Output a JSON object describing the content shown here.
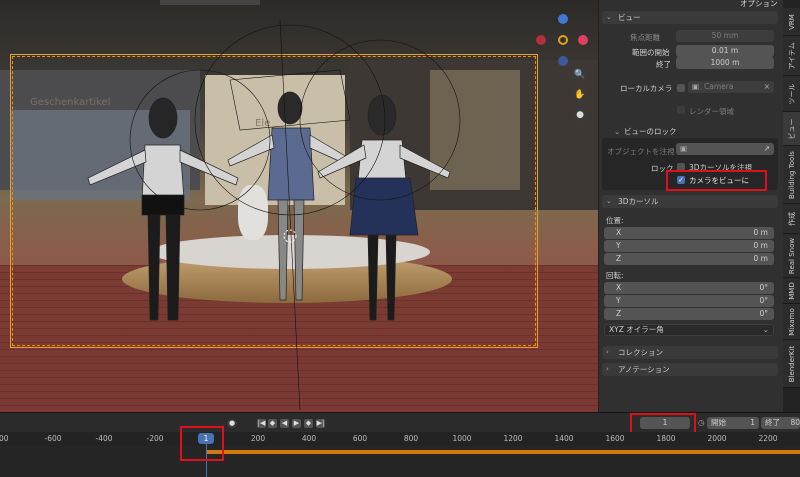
{
  "viewport": {
    "shop_sign": "Geschenkartikel",
    "shop_sign_partial": "Ele"
  },
  "npanel": {
    "section_view": "ビュー",
    "focal_length_label": "焦点距離",
    "focal_length_value": "50 mm",
    "clip_start_label": "範囲の開始",
    "clip_start_value": "0.01 m",
    "clip_end_label": "終了",
    "clip_end_value": "1000 m",
    "local_camera_label": "ローカルカメラ",
    "local_camera_value": "Camera",
    "render_region_label": "レンダー領域",
    "section_view_lock": "ビューのロック",
    "lock_object_label": "オブジェクトを注視",
    "lock_label": "ロック",
    "lock_3d_cursor_label": "3Dカーソルを注視",
    "camera_to_view_label": "カメラをビューに",
    "section_3d_cursor": "3Dカーソル",
    "location_label": "位置:",
    "rotation_label": "回転:",
    "loc": [
      {
        "axis": "X",
        "value": "0 m"
      },
      {
        "axis": "Y",
        "value": "0 m"
      },
      {
        "axis": "Z",
        "value": "0 m"
      }
    ],
    "rot": [
      {
        "axis": "X",
        "value": "0°"
      },
      {
        "axis": "Y",
        "value": "0°"
      },
      {
        "axis": "Z",
        "value": "0°"
      }
    ],
    "rotation_mode": "XYZ オイラー角",
    "section_collection": "コレクション",
    "section_annotation": "アノテーション",
    "top_right": "オプション"
  },
  "tabs": [
    "VRM",
    "アイテム",
    "ツール",
    "ビュー",
    "Building Tools",
    "作成",
    "Real Snow",
    "MMD",
    "Mixamo",
    "BlenderKit"
  ],
  "timeline": {
    "current_frame": "1",
    "start_label": "開始",
    "start_value": "1",
    "end_label": "終了",
    "end_value": "80",
    "playhead_frame": "1",
    "ticks": [
      "-800",
      "-600",
      "-400",
      "-200",
      "200",
      "400",
      "600",
      "800",
      "1000",
      "1200",
      "1400",
      "1600",
      "1800",
      "2000",
      "2200"
    ]
  },
  "colors": {
    "accent": "#4772b3",
    "highlight": "#e0101a",
    "camera_frame": "#f0a020",
    "frame_range": "#d07a10"
  }
}
